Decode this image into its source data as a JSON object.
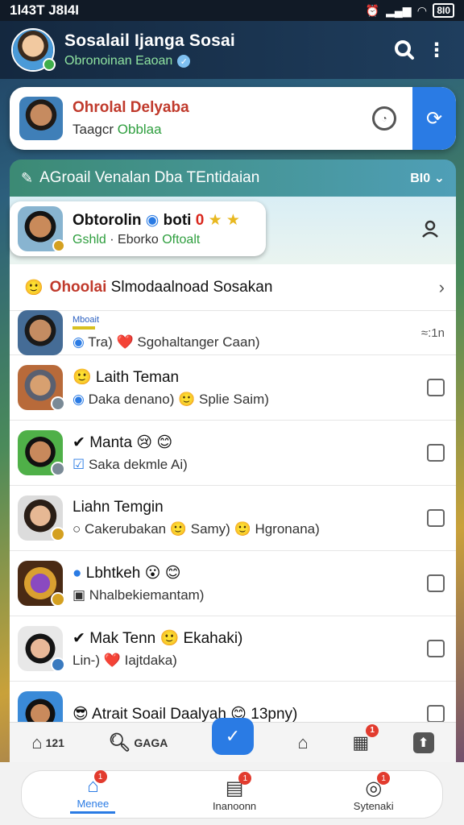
{
  "status": {
    "time": "1l43T J8I4I",
    "battery": "8I0"
  },
  "header": {
    "title": "Sosalail Ijanga Sosai",
    "subtitle": "Obronoinan Eaoan"
  },
  "profile": {
    "name": "Ohrolal Delyaba",
    "sub_prefix": "Taagcr",
    "sub_green": "Obblaa"
  },
  "section": {
    "label": "AGroail Venalan Dba TEntidaian",
    "right": "BI0 ⌄"
  },
  "featured": {
    "name": "Obtorolin",
    "name2": "boti",
    "red": "0",
    "tag1": "Gshld",
    "tag2": "Eborko",
    "tag3": "Oftoalt"
  },
  "group": {
    "emoji": "🙂",
    "title_red": "Ohoolai",
    "title_rest": " Slmodaalnoad Sosakan"
  },
  "chats": [
    {
      "label": "Mboait",
      "name": "",
      "msg": "Tra)  ❤️  Sgohaltanger Caan)",
      "time": "≈:1n",
      "checkbox": false
    },
    {
      "name": "🙂 Laith Teman",
      "msg": "Daka denano)  🙂 Splie Saim)",
      "checkbox": true
    },
    {
      "name": "✔ Manta  😢 😊",
      "msg": "Saka dekmle Ai)",
      "checkbox": true
    },
    {
      "name": "Liahn Temgin",
      "msg": "○ Cakerubakan  🙂 Samy)  🙂 Hgronana)",
      "checkbox": true
    },
    {
      "name": "Lbhtkeh  😮 😊",
      "msg": "Nhalbekiemantam)",
      "checkbox": true
    },
    {
      "name": "✔ Mak Tenn  🙂 Ekahaki)",
      "msg": "Lin-)  ❤️  Iajtdaka)",
      "checkbox": true
    },
    {
      "name": "😎 Atrait Soail Daalyah  😊 13pny)",
      "msg": "",
      "checkbox": true
    }
  ],
  "toolbar": {
    "left_text": "121",
    "search_text": "GAGA",
    "badge1": "1"
  },
  "nav": [
    {
      "label": "Menee",
      "icon": "home-icon",
      "badge": "1"
    },
    {
      "label": "Inanoonn",
      "icon": "store-icon",
      "badge": "1"
    },
    {
      "label": "Sytenaki",
      "icon": "profile-icon",
      "badge": "1"
    }
  ],
  "colors": {
    "accent": "#2a7be4",
    "danger": "#d9261c",
    "success": "#2e9e3e"
  }
}
